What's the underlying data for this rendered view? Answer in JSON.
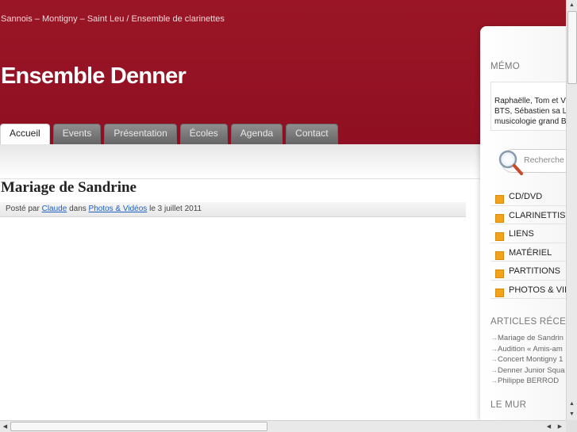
{
  "header": {
    "tagline": "Sannois – Montigny – Saint Leu / Ensemble de clarinettes",
    "title": "Ensemble Denner",
    "brand_color": "#8f1022"
  },
  "nav": {
    "tabs": [
      {
        "label": "Accueil",
        "active": true
      },
      {
        "label": "Events"
      },
      {
        "label": "Présentation"
      },
      {
        "label": "Écoles"
      },
      {
        "label": "Agenda"
      },
      {
        "label": "Contact"
      }
    ]
  },
  "post": {
    "title": "Mariage de Sandrine",
    "meta_prefix": "Posté par",
    "author": "Claude",
    "meta_in": "dans",
    "category": "Photos & Vidéos",
    "meta_date_prefix": "le",
    "date": "3 juillet 2011"
  },
  "sidebar": {
    "memo_heading": "MÉMO",
    "memo_lines": [
      "Raphaëlle, Tom et V",
      "BTS, Sébastien sa L",
      "musicologie grand B"
    ],
    "search_placeholder": "Recherche",
    "categories": [
      {
        "label": "CD/DVD"
      },
      {
        "label": "CLARINETTIST"
      },
      {
        "label": "LIENS"
      },
      {
        "label": "MATÉRIEL"
      },
      {
        "label": "PARTITIONS"
      },
      {
        "label": "PHOTOS & VID"
      }
    ],
    "category_marker_color": "#f2a21b",
    "recent_heading": "ARTICLES RÉCE",
    "recent": [
      {
        "label": "Mariage de Sandrin"
      },
      {
        "label": "Audition « Amis-am"
      },
      {
        "label": "Concert Montigny 1"
      },
      {
        "label": "Denner Junior Squa"
      },
      {
        "label": "Philippe BERROD"
      }
    ],
    "wall_heading": "LE MUR"
  }
}
